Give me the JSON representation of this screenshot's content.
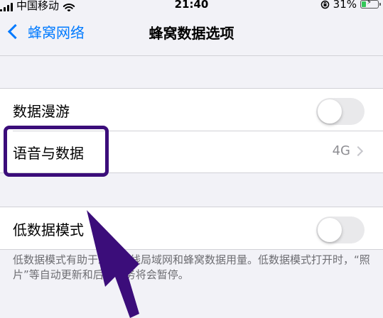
{
  "status_bar": {
    "carrier": "中国移动",
    "time": "21:40",
    "battery_percent": "31%",
    "battery_level": 0.31
  },
  "nav": {
    "back_label": "蜂窝网络",
    "title": "蜂窝数据选项"
  },
  "group1": {
    "rows": [
      {
        "label": "数据漫游",
        "toggle_on": false
      },
      {
        "label": "语音与数据",
        "value": "4G"
      }
    ]
  },
  "group2": {
    "rows": [
      {
        "label": "低数据模式",
        "toggle_on": false
      }
    ],
    "footer": "低数据模式有助于减少无线局域网和蜂窝数据用量。低数据模式打开时，“照片”等自动更新和后台任务将会暂停。"
  },
  "colors": {
    "accent": "#007aff",
    "annotation": "#3b0d7a",
    "battery_fill": "#34c759"
  }
}
